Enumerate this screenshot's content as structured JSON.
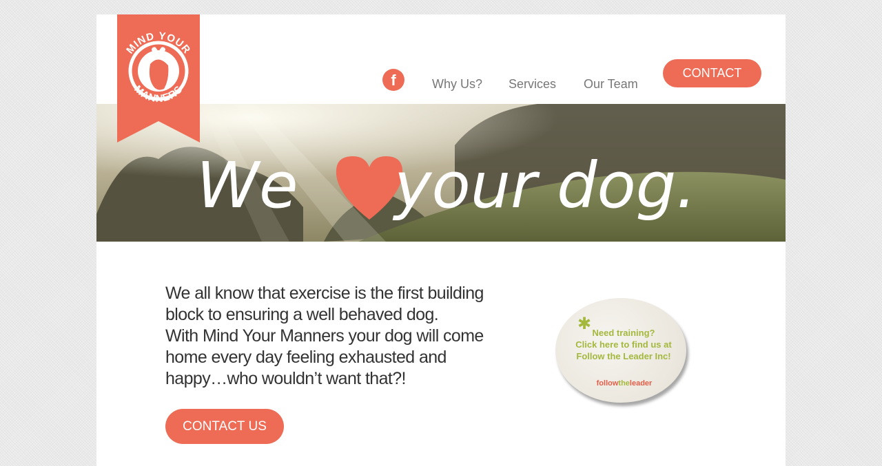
{
  "brand": {
    "logo_top": "MIND YOUR",
    "logo_bottom": "MANNERS",
    "color": "#ee6b55"
  },
  "nav": {
    "facebook_icon": "facebook-icon",
    "links": [
      "Why Us?",
      "Services",
      "Our Team"
    ],
    "contact_label": "CONTACT"
  },
  "hero": {
    "word_left": "We",
    "word_right": "your dog."
  },
  "main": {
    "paragraph_lines": [
      "We all know that exercise is the first building",
      "block to ensuring a well behaved dog.",
      "With Mind Your Manners your dog will come",
      "home every day feeling exhausted and",
      "happy…who wouldn’t want that?!"
    ],
    "cta_label": "CONTACT US"
  },
  "badge": {
    "lines": [
      "Need training?",
      "Click here to find us at",
      "Follow the Leader Inc!"
    ],
    "logo_follow": "follow",
    "logo_the": "the",
    "logo_leader": "leader",
    "accent": "#a4b83e"
  }
}
